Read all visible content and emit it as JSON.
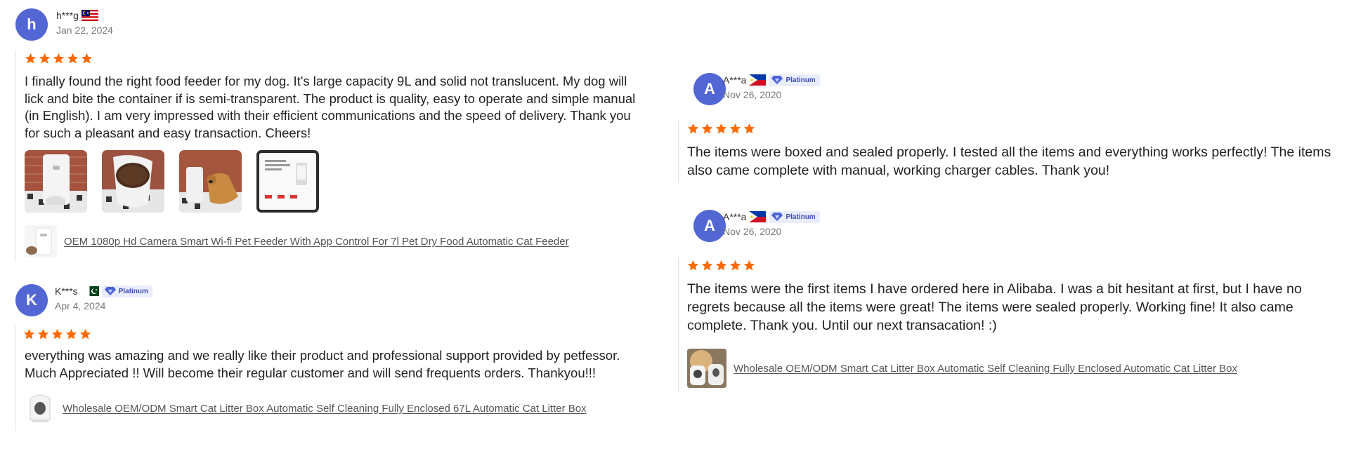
{
  "colors": {
    "avatar": "#5266d4",
    "star": "#ff6a00",
    "badge_bg": "#e9ecfb",
    "badge_text": "#3c4fb5"
  },
  "reviews": [
    {
      "avatar_letter": "h",
      "name": "h***g",
      "flag": "Malaysia",
      "date": "Jan 22, 2024",
      "rating": 5,
      "text": "I finally found the right food feeder for my dog. It's large capacity 9L and solid not translucent. My dog will lick and bite the container if is semi-transparent. The product is quality, easy to operate and simple manual (in English). I am very impressed with their efficient communications and the speed of delivery. Thank you for such a pleasant and easy transaction. Cheers!",
      "photos": [
        "feeder-photo-1",
        "feeder-bowl-photo",
        "dog-feeder-photo",
        "manual-photo"
      ],
      "product_link": "OEM 1080p Hd Camera Smart Wi-fi Pet Feeder With App Control For 7l Pet Dry Food Automatic Cat Feeder"
    },
    {
      "avatar_letter": "K",
      "name": "K***s",
      "flag": "Pakistan",
      "badge": "Platinum",
      "date": "Apr 4, 2024",
      "rating": 5,
      "text": "everything was amazing and we really like their product and professional support provided by petfessor. Much Appreciated !! Will become their regular customer and will send frequents orders. Thankyou!!!",
      "product_link": "Wholesale OEM/ODM Smart Cat Litter Box Automatic Self Cleaning Fully Enclosed 67L Automatic Cat Litter Box"
    },
    {
      "avatar_letter": "A",
      "name": "A***a",
      "flag": "Philippines",
      "badge": "Platinum",
      "date": "Nov 26, 2020",
      "rating": 5,
      "text": "The items were boxed and sealed properly. I tested all the items and everything works perfectly! The items also came complete with manual, working charger cables. Thank you!"
    },
    {
      "avatar_letter": "A",
      "name": "A***a",
      "flag": "Philippines",
      "badge": "Platinum",
      "date": "Nov 26, 2020",
      "rating": 5,
      "text": "The items were the first items I have ordered here in Alibaba. I was a bit hesitant at first, but I have no regrets because all the items were great! The items were sealed properly. Working fine! It also came complete. Thank you. Until our next transacation! :)",
      "product_link": "Wholesale OEM/ODM Smart Cat Litter Box Automatic Self Cleaning Fully Enclosed Automatic Cat Litter Box"
    }
  ]
}
